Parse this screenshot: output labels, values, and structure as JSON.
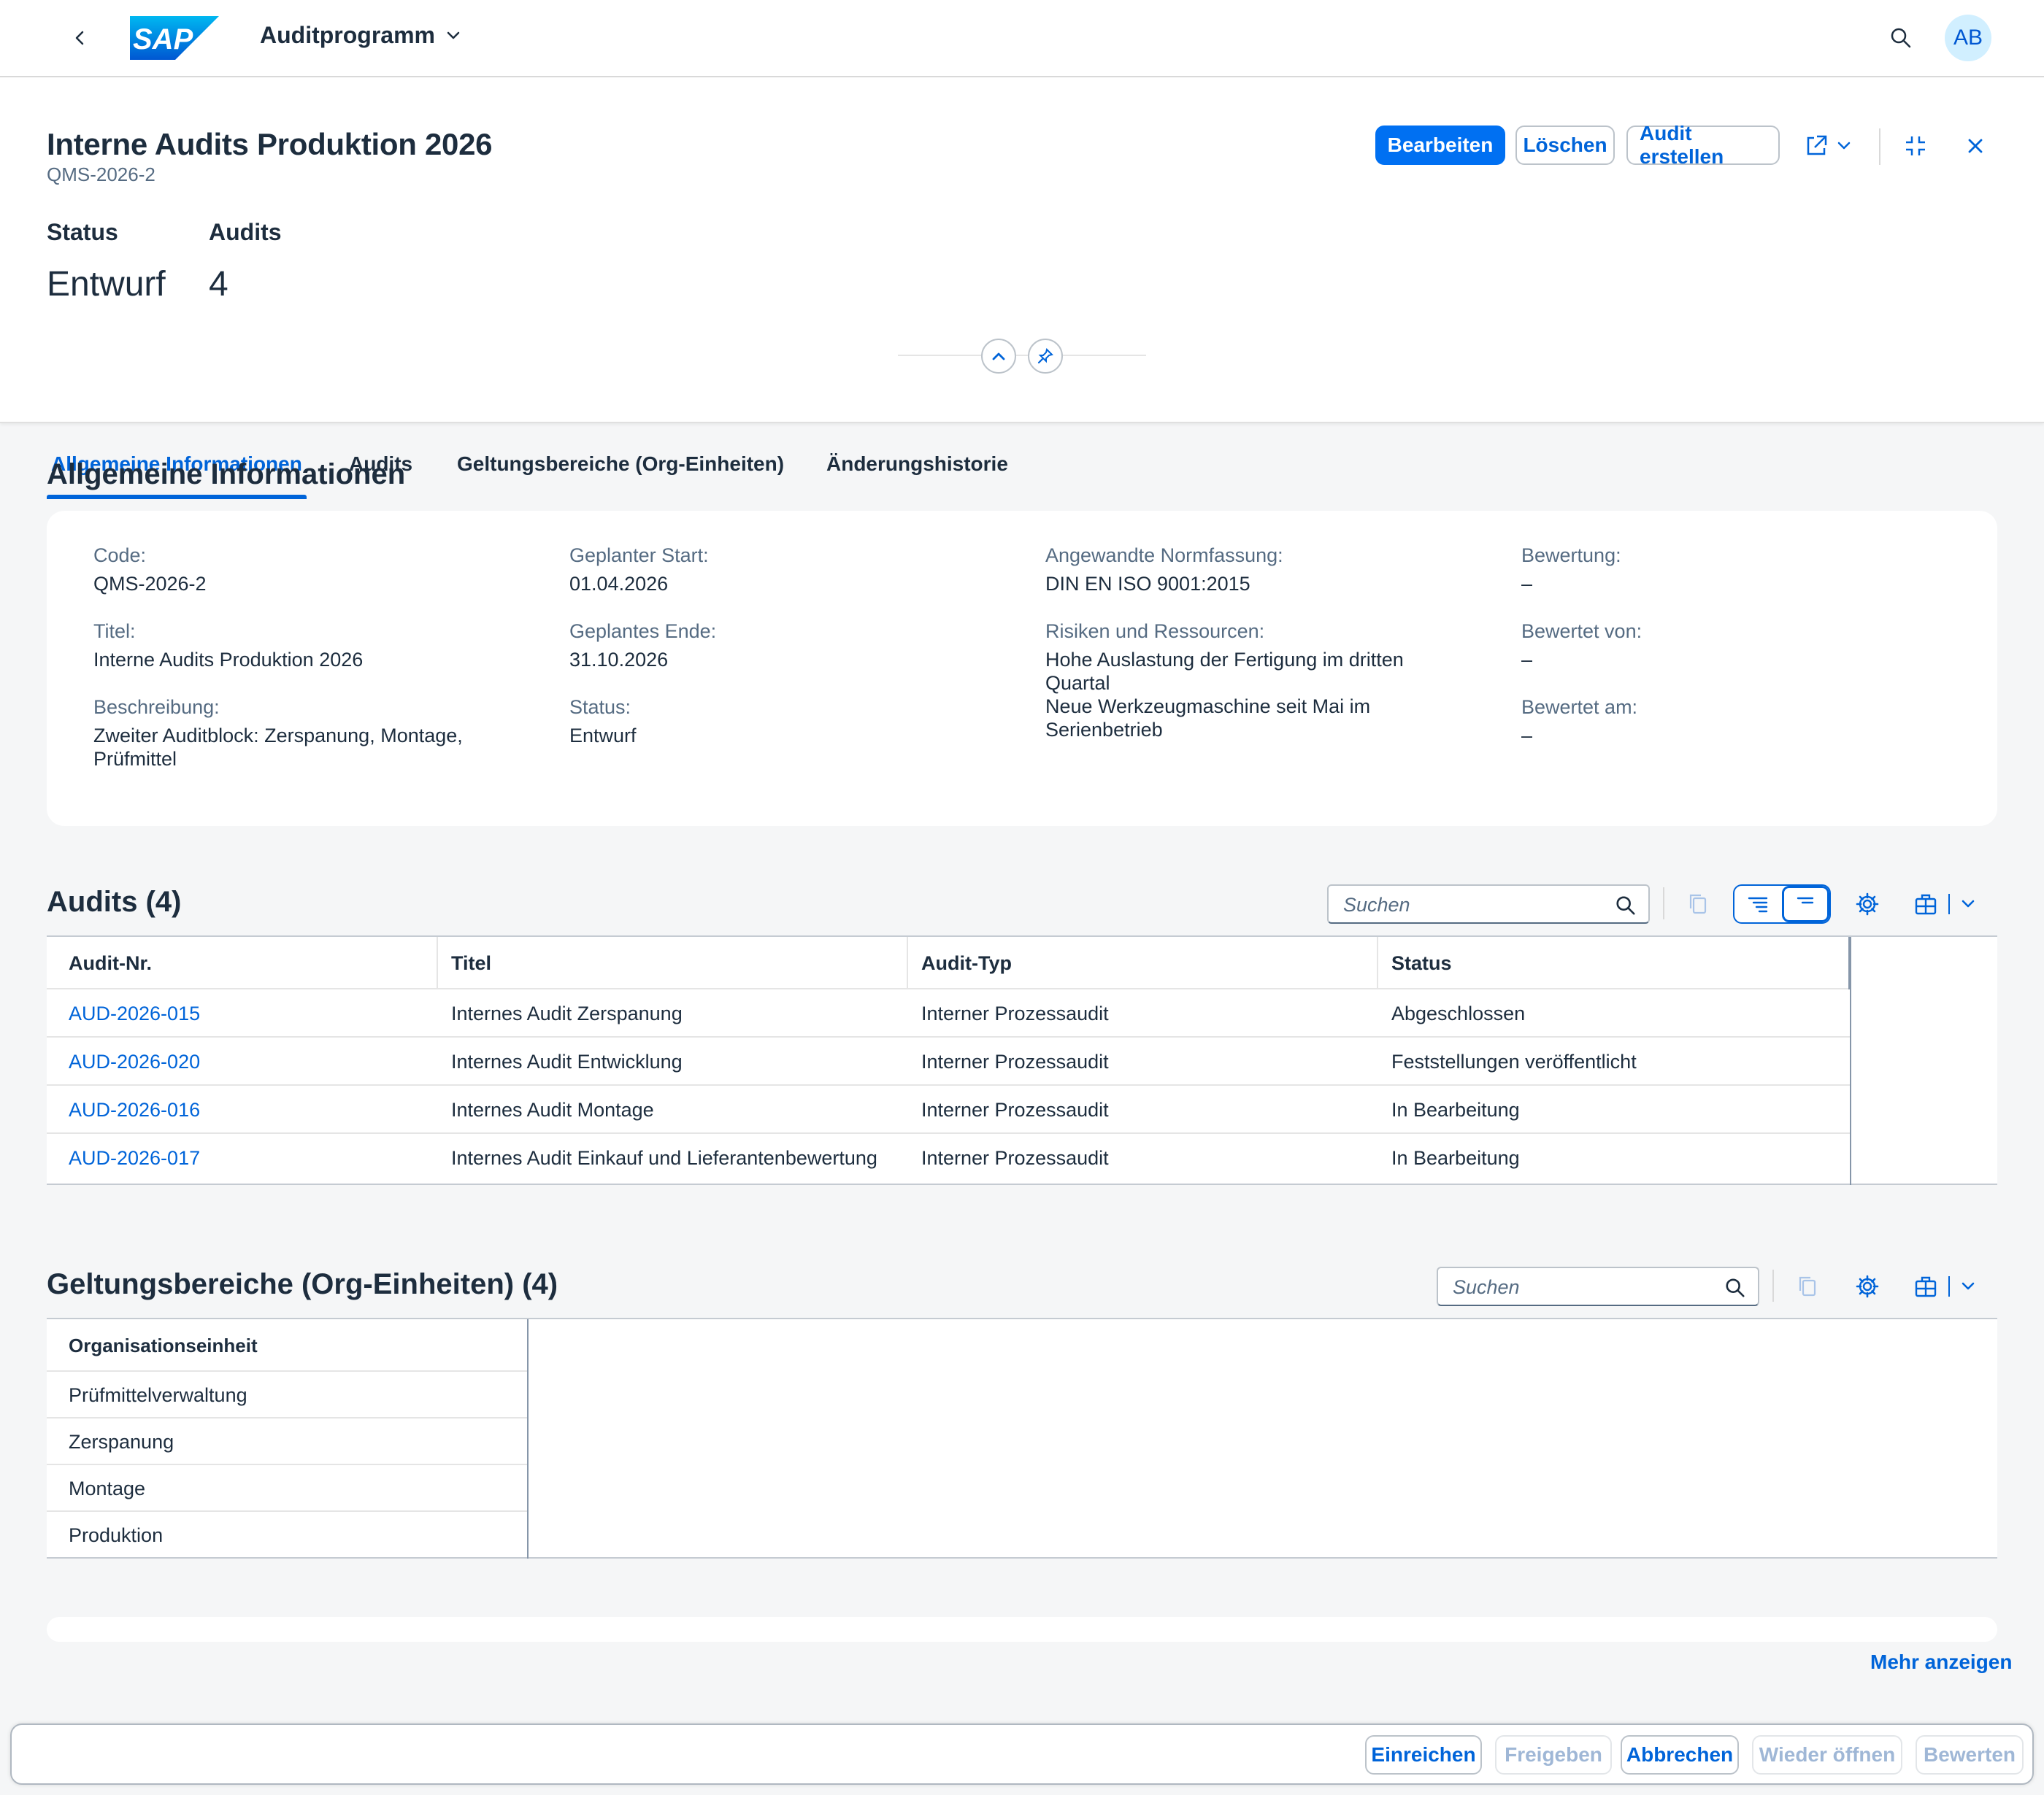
{
  "shell": {
    "app_title": "Auditprogramm",
    "logo_text": "SAP",
    "avatar_initials": "AB"
  },
  "header": {
    "title": "Interne Audits Produktion 2026",
    "subtitle": "QMS-2026-2",
    "kpis": [
      {
        "label": "Status",
        "value": "Entwurf"
      },
      {
        "label": "Audits",
        "value": "4"
      }
    ],
    "actions": {
      "edit": "Bearbeiten",
      "delete": "Löschen",
      "create_audit": "Audit erstellen"
    }
  },
  "tabs": [
    {
      "label": "Allgemeine Informationen",
      "active": true
    },
    {
      "label": "Audits",
      "active": false
    },
    {
      "label": "Geltungsbereiche (Org-Einheiten)",
      "active": false
    },
    {
      "label": "Änderungshistorie",
      "active": false
    }
  ],
  "general": {
    "section_title": "Allgemeine Informationen",
    "fields": {
      "code": {
        "label": "Code:",
        "value": "QMS-2026-2"
      },
      "title": {
        "label": "Titel:",
        "value": "Interne Audits Produktion 2026"
      },
      "description": {
        "label": "Beschreibung:",
        "value": "Zweiter Auditblock: Zerspanung, Montage, Prüfmittel"
      },
      "planned_start": {
        "label": "Geplanter Start:",
        "value": "01.04.2026"
      },
      "planned_end": {
        "label": "Geplantes Ende:",
        "value": "31.10.2026"
      },
      "status": {
        "label": "Status:",
        "value": "Entwurf"
      },
      "norm": {
        "label": "Angewandte Normfassung:",
        "value": "DIN EN ISO 9001:2015"
      },
      "risks": {
        "label": "Risiken und Ressourcen:",
        "value_1": "Hohe Auslastung der Fertigung im dritten Quartal",
        "value_2": "Neue Werkzeugmaschine seit Mai im Serienbetrieb"
      },
      "rating": {
        "label": "Bewertung:",
        "value": "–"
      },
      "rated_by": {
        "label": "Bewertet von:",
        "value": "–"
      },
      "rated_on": {
        "label": "Bewertet am:",
        "value": "–"
      }
    }
  },
  "audits": {
    "section_title": "Audits (4)",
    "search_placeholder": "Suchen",
    "columns": [
      "Audit-Nr.",
      "Titel",
      "Audit-Typ",
      "Status"
    ],
    "rows": [
      [
        "AUD-2026-015",
        "Internes Audit Zerspanung",
        "Interner Prozessaudit",
        "Abgeschlossen"
      ],
      [
        "AUD-2026-020",
        "Internes Audit Entwicklung",
        "Interner Prozessaudit",
        "Feststellungen veröffentlicht"
      ],
      [
        "AUD-2026-016",
        "Internes Audit Montage",
        "Interner Prozessaudit",
        "In Bearbeitung"
      ],
      [
        "AUD-2026-017",
        "Internes Audit Einkauf und Lieferantenbewertung",
        "Interner Prozessaudit",
        "In Bearbeitung"
      ]
    ]
  },
  "scopes": {
    "section_title": "Geltungsbereiche (Org-Einheiten) (4)",
    "search_placeholder": "Suchen",
    "columns": [
      "Organisationseinheit"
    ],
    "rows": [
      "Prüfmittelverwaltung",
      "Zerspanung",
      "Montage",
      "Produktion"
    ]
  },
  "more_link": "Mehr anzeigen",
  "footer": {
    "buttons": [
      {
        "label": "Einreichen",
        "enabled": true
      },
      {
        "label": "Freigeben",
        "enabled": false
      },
      {
        "label": "Abbrechen",
        "enabled": true
      },
      {
        "label": "Wieder öffnen",
        "enabled": false
      },
      {
        "label": "Bewerten",
        "enabled": false
      }
    ]
  },
  "colors": {
    "brand": "#0070f2",
    "link": "#0064d9",
    "text": "#1d2d3e",
    "label": "#556b82",
    "background": "#f5f6f7"
  }
}
